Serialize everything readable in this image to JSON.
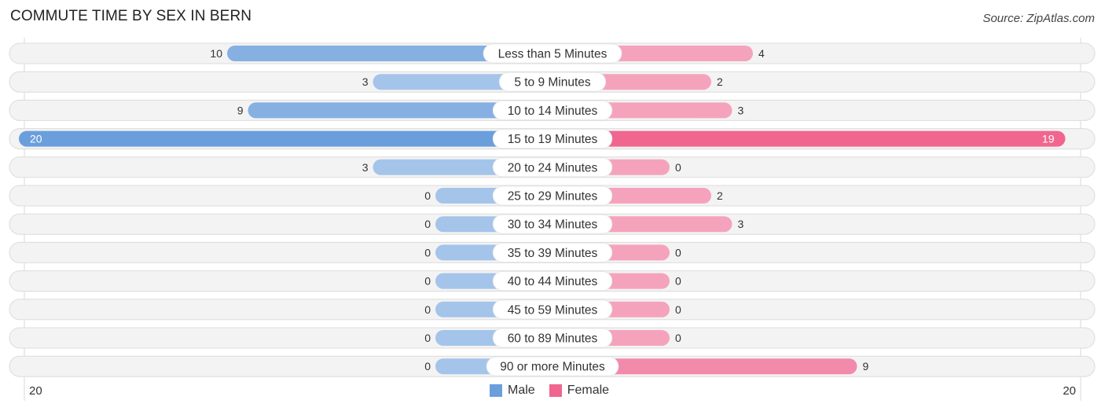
{
  "header": {
    "title": "COMMUTE TIME BY SEX IN BERN",
    "source": "Source: ZipAtlas.com"
  },
  "colors": {
    "male": "#6a9fdc",
    "male_light": "#a4c4ea",
    "female": "#f0668f",
    "female_light": "#f5a3bd",
    "track": "#f3f3f3",
    "track_border": "#dcdcdc"
  },
  "chart_data": {
    "type": "bar",
    "orientation": "horizontal-diverging",
    "title": "COMMUTE TIME BY SEX IN BERN",
    "categories": [
      "Less than 5 Minutes",
      "5 to 9 Minutes",
      "10 to 14 Minutes",
      "15 to 19 Minutes",
      "20 to 24 Minutes",
      "25 to 29 Minutes",
      "30 to 34 Minutes",
      "35 to 39 Minutes",
      "40 to 44 Minutes",
      "45 to 59 Minutes",
      "60 to 89 Minutes",
      "90 or more Minutes"
    ],
    "series": [
      {
        "name": "Male",
        "values": [
          10,
          3,
          9,
          20,
          3,
          0,
          0,
          0,
          0,
          0,
          0,
          0
        ]
      },
      {
        "name": "Female",
        "values": [
          4,
          2,
          3,
          19,
          0,
          2,
          3,
          0,
          0,
          0,
          0,
          9
        ]
      }
    ],
    "axis": {
      "left_max_label": "20",
      "right_max_label": "20",
      "range": [
        0,
        20
      ]
    },
    "legend": {
      "position": "bottom-center",
      "entries": [
        "Male",
        "Female"
      ]
    }
  }
}
